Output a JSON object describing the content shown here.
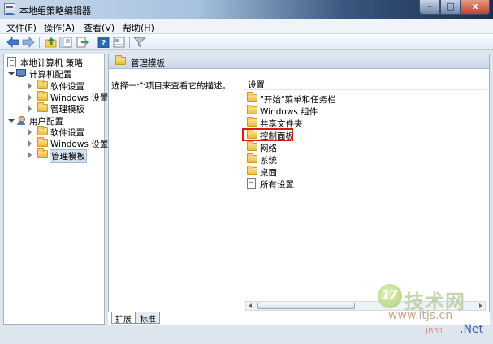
{
  "window": {
    "title": "本地组策略编辑器",
    "buttons": {
      "minimize": "–",
      "maximize": "□",
      "close": "x"
    }
  },
  "menubar": {
    "items": [
      "文件(F)",
      "操作(A)",
      "查看(V)",
      "帮助(H)"
    ]
  },
  "toolbar": {
    "icons": [
      "back-arrow-icon",
      "forward-arrow-icon",
      "up-folder-icon",
      "show-hide-tree-icon",
      "export-list-icon",
      "help-icon",
      "properties-icon",
      "filter-icon"
    ]
  },
  "tree": {
    "root": "本地计算机 策略",
    "computer_config": "计算机配置",
    "computer_children": [
      "软件设置",
      "Windows 设置",
      "管理模板"
    ],
    "user_config": "用户配置",
    "user_children": [
      "软件设置",
      "Windows 设置",
      "管理模板"
    ],
    "selected": "管理模板"
  },
  "detail": {
    "header_title": "管理模板",
    "description": "选择一个项目来查看它的描述。",
    "list_header": "设置",
    "items": [
      {
        "label": "\"开始\"菜单和任务栏",
        "icon": "folder-icon"
      },
      {
        "label": "Windows 组件",
        "icon": "folder-icon"
      },
      {
        "label": "共享文件夹",
        "icon": "folder-icon"
      },
      {
        "label": "控制面板",
        "icon": "folder-icon",
        "highlighted": true
      },
      {
        "label": "网络",
        "icon": "folder-icon"
      },
      {
        "label": "系统",
        "icon": "folder-icon"
      },
      {
        "label": "桌面",
        "icon": "folder-icon"
      },
      {
        "label": "所有设置",
        "icon": "document-icon"
      }
    ],
    "highlight_color": "#d7191c"
  },
  "tabs": [
    "扩展",
    "标准"
  ],
  "watermark": {
    "number": "17",
    "brand": "技术网",
    "url": "www.itjs.cn",
    "small": "JB51",
    "net": ".Net"
  }
}
